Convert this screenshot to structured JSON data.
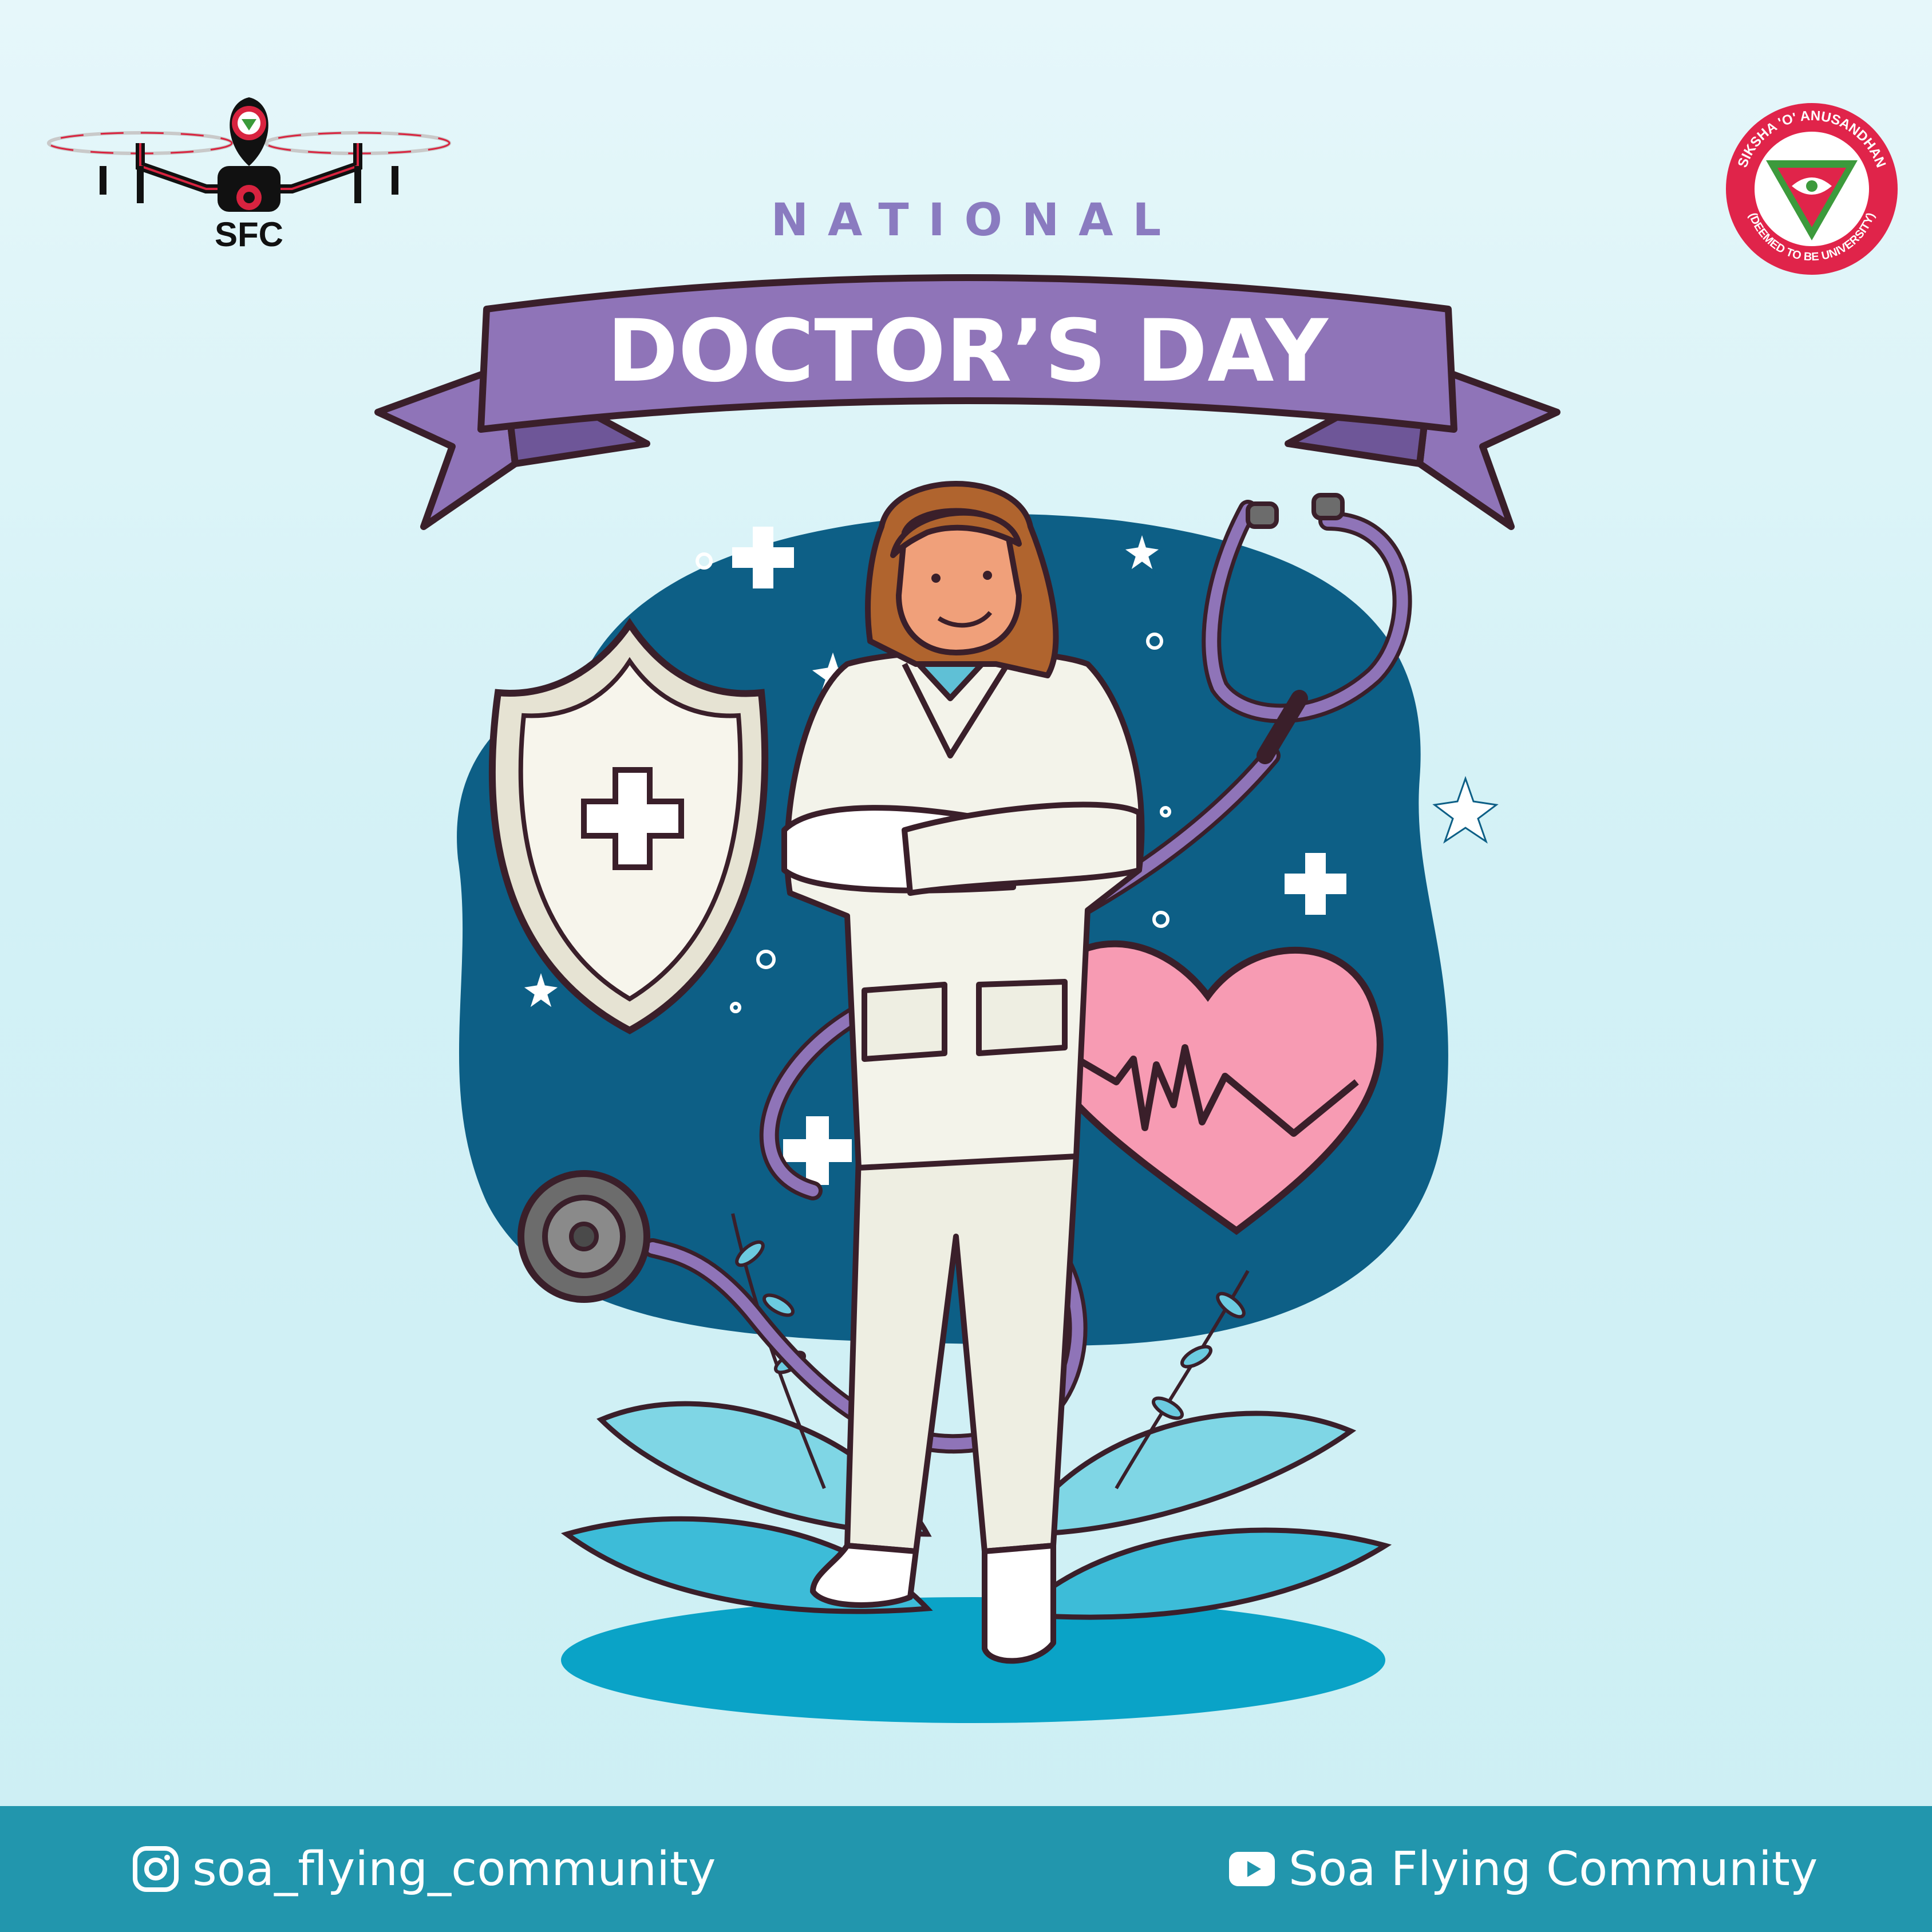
{
  "header": {
    "brand_logo_text": "SFC",
    "university_seal_text": "SIKSHA 'O' ANUSANDHAN",
    "university_seal_subtext": "(DEEMED TO BE UNIVERSITY)"
  },
  "title": {
    "eyebrow": "NATIONAL",
    "banner": "DOCTOR’S DAY"
  },
  "footer": {
    "instagram_handle": "soa_flying_community",
    "youtube_channel": "Soa Flying Community"
  },
  "colors": {
    "background": "#d3f1f6",
    "banner": "#8f74b8",
    "eyebrow": "#8a7bc0",
    "footer": "#2296ad",
    "blob": "#0d5f86",
    "heart": "#f79bb3",
    "brand_red": "#d8233f"
  },
  "icons": [
    "drone-icon",
    "university-seal-icon",
    "instagram-icon",
    "youtube-icon",
    "shield-cross-icon",
    "heart-pulse-icon",
    "stethoscope-icon",
    "plus-icon",
    "sparkle-icon"
  ]
}
